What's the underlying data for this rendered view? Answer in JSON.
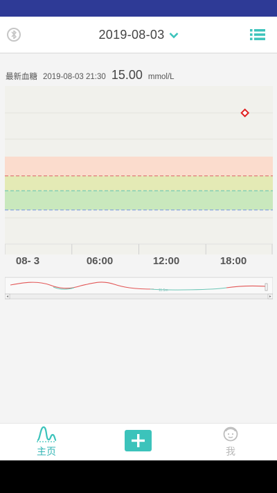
{
  "header": {
    "date": "2019-08-03"
  },
  "latest": {
    "label": "最新血糖",
    "timestamp": "2019-08-03 21:30",
    "value": "15.00",
    "unit": "mmol/L"
  },
  "chart_data": {
    "type": "line",
    "x_tick_labels": [
      "08- 3",
      "06:00",
      "12:00",
      "18:00"
    ],
    "x_range_hours": [
      0,
      24
    ],
    "y_max": 18,
    "bands": [
      {
        "from": 7.8,
        "to": 10.0,
        "color": "#fbdccd"
      },
      {
        "from": 6.1,
        "to": 7.8,
        "color": "#e4eab5"
      },
      {
        "from": 3.9,
        "to": 6.1,
        "color": "#c9e8bd"
      }
    ],
    "thresholds": [
      {
        "value": 7.8,
        "color": "#e07a7a"
      },
      {
        "value": 6.1,
        "color": "#6cc6b6"
      },
      {
        "value": 3.9,
        "color": "#7f9ce0"
      }
    ],
    "points": [
      {
        "time_hours": 21.5,
        "value": 15.0,
        "color": "#e02020"
      }
    ],
    "overview_label": "11.5m"
  },
  "colors": {
    "accent": "#3cc3bb",
    "status_bar": "#2e3a96",
    "tab_active": "#33b5b5",
    "tab_inactive": "#b8b8b8"
  },
  "tabs": {
    "home": "主页",
    "me": "我"
  },
  "icons": {
    "bluetooth": "bluetooth-off-icon",
    "list": "list-icon",
    "home": "wave-home-icon",
    "add": "plus-icon",
    "me": "face-icon"
  }
}
